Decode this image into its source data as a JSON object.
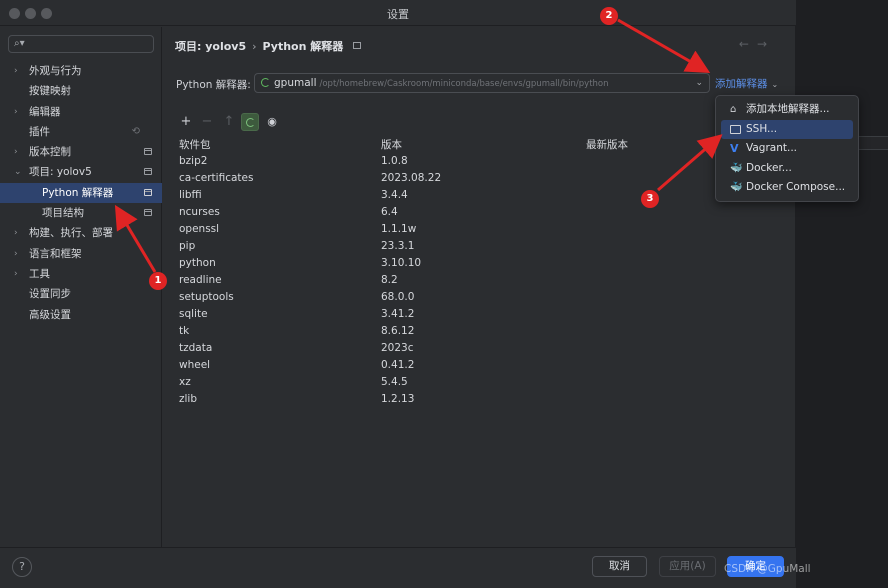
{
  "window": {
    "title": "设置"
  },
  "search": {
    "icon": "search-icon"
  },
  "sidebar": {
    "items": [
      {
        "label": "外观与行为",
        "expandable": true
      },
      {
        "label": "按键映射",
        "expandable": false
      },
      {
        "label": "编辑器",
        "expandable": true
      },
      {
        "label": "插件",
        "expandable": false
      },
      {
        "label": "版本控制",
        "expandable": true
      },
      {
        "label": "项目: yolov5",
        "expandable": true,
        "expanded": true
      },
      {
        "label": "Python 解释器",
        "child": true,
        "selected": true
      },
      {
        "label": "项目结构",
        "child": true
      },
      {
        "label": "构建、执行、部署",
        "expandable": true
      },
      {
        "label": "语言和框架",
        "expandable": true
      },
      {
        "label": "工具",
        "expandable": true
      },
      {
        "label": "设置同步",
        "expandable": false
      },
      {
        "label": "高级设置",
        "expandable": false
      }
    ]
  },
  "breadcrumb": {
    "project": "项目: yolov5",
    "separator": "›",
    "page": "Python 解释器"
  },
  "interpreter": {
    "label": "Python 解释器:",
    "name": "gpumall",
    "path": "/opt/homebrew/Caskroom/miniconda/base/envs/gpumall/bin/python",
    "add_label": "添加解释器"
  },
  "toolbar": {
    "add": "+",
    "remove": "−",
    "up": "↑",
    "eye": "👁"
  },
  "table": {
    "headers": [
      "软件包",
      "版本",
      "最新版本"
    ],
    "rows": [
      [
        "bzip2",
        "1.0.8"
      ],
      [
        "ca-certificates",
        "2023.08.22"
      ],
      [
        "libffi",
        "3.4.4"
      ],
      [
        "ncurses",
        "6.4"
      ],
      [
        "openssl",
        "1.1.1w"
      ],
      [
        "pip",
        "23.3.1"
      ],
      [
        "python",
        "3.10.10"
      ],
      [
        "readline",
        "8.2"
      ],
      [
        "setuptools",
        "68.0.0"
      ],
      [
        "sqlite",
        "3.41.2"
      ],
      [
        "tk",
        "8.6.12"
      ],
      [
        "tzdata",
        "2023c"
      ],
      [
        "wheel",
        "0.41.2"
      ],
      [
        "xz",
        "5.4.5"
      ],
      [
        "zlib",
        "1.2.13"
      ]
    ]
  },
  "popup": {
    "items": [
      {
        "label": "添加本地解释器...",
        "icon": "home-icon"
      },
      {
        "label": "SSH...",
        "icon": "terminal-icon",
        "selected": true
      },
      {
        "label": "Vagrant...",
        "icon": "vagrant-icon"
      },
      {
        "label": "Docker...",
        "icon": "docker-icon"
      },
      {
        "label": "Docker Compose...",
        "icon": "docker-icon"
      }
    ]
  },
  "footer": {
    "help": "?",
    "cancel": "取消",
    "apply": "应用(A)",
    "ok": "确定"
  },
  "annotations": [
    "1",
    "2",
    "3"
  ],
  "watermark": "CSDN @GpuMall",
  "colors": {
    "accent": "#3574f0",
    "selection": "#2e436e",
    "annotation": "#e02424",
    "link": "#5c8fe6"
  }
}
